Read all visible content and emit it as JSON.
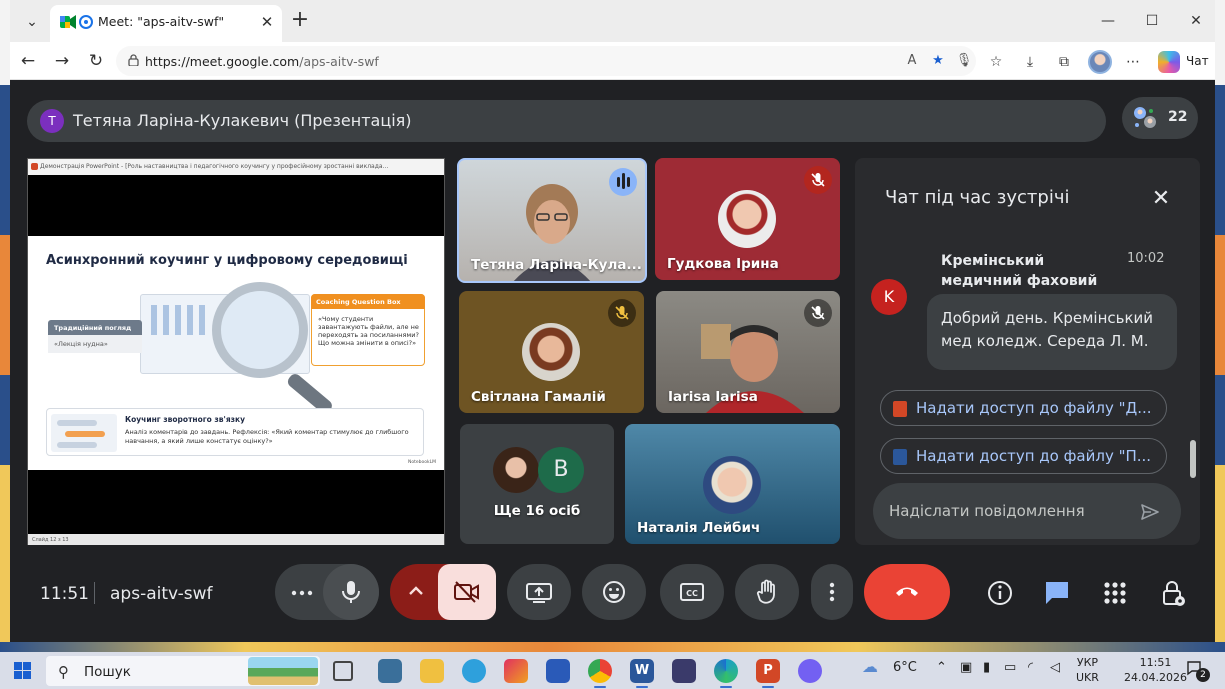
{
  "browser": {
    "tab_title": "Meet: \"aps-aitv-swf\"",
    "url_host": "https://meet.google.com",
    "url_path": "/aps-aitv-swf",
    "copilot_label": "Чат"
  },
  "meet": {
    "presenter": {
      "avatar_letter": "Т",
      "title": "Тетяна Ларіна-Кулакевич (Презентація)"
    },
    "participant_count": "22",
    "presentation": {
      "window_title": "Демонстрація PowerPoint - [Роль наставництва і педагогічного коучингу у професійному зростанні виклада...",
      "slide_heading": "Асинхронний коучинг у цифровому середовищі",
      "trad_title": "Традиційний погляд",
      "trad_text": "«Лекція нудна»",
      "cq_title": "Coaching Question Box",
      "cq_text": "«Чому студенти завантажують файли, але не переходять за посиланнями? Що можна змінити в описі?»",
      "coach_title": "Коучинг зворотного зв'язку",
      "coach_text": "Аналіз коментарів до завдань. Рефлексія: «Який коментар стимулює до глибшого навчання, а який лише констатує оцінку?»",
      "logo": "NotebookLM",
      "status": "Слайд 12 з 13"
    },
    "tiles": [
      {
        "name": "Тетяна Ларіна-Кула...",
        "speaking": true
      },
      {
        "name": "Гудкова Ірина",
        "muted": true
      },
      {
        "name": "Світлана Гамалій",
        "muted": true
      },
      {
        "name": "Iarisa Iarisa",
        "muted": true
      },
      {
        "name": "Ще 16 осіб",
        "avatar_letter": "В"
      },
      {
        "name": "Наталія Лейбич"
      }
    ],
    "chat": {
      "title": "Чат під час зустрічі",
      "message": {
        "avatar_letter": "K",
        "sender": "Кремінський медичний фаховий коледж",
        "time": "10:02",
        "text": "Добрий день. Кремінський мед коледж. Середа Л. М."
      },
      "files": [
        "Надати доступ до файлу \"Д...",
        "Надати доступ до файлу \"П..."
      ],
      "input_placeholder": "Надіслати повідомлення"
    },
    "bottom": {
      "time": "11:51",
      "meeting_code": "aps-aitv-swf"
    }
  },
  "taskbar": {
    "search_label": "Пошук",
    "weather": "6°C",
    "lang_top": "УКР",
    "lang_bottom": "UKR",
    "time": "11:51",
    "date": "24.04.2026",
    "notifications": "2"
  },
  "colors": {
    "meet_bg": "#202124",
    "end_call": "#ea4335",
    "camera_off": "#f9dedc",
    "link": "#a8c7fa"
  }
}
